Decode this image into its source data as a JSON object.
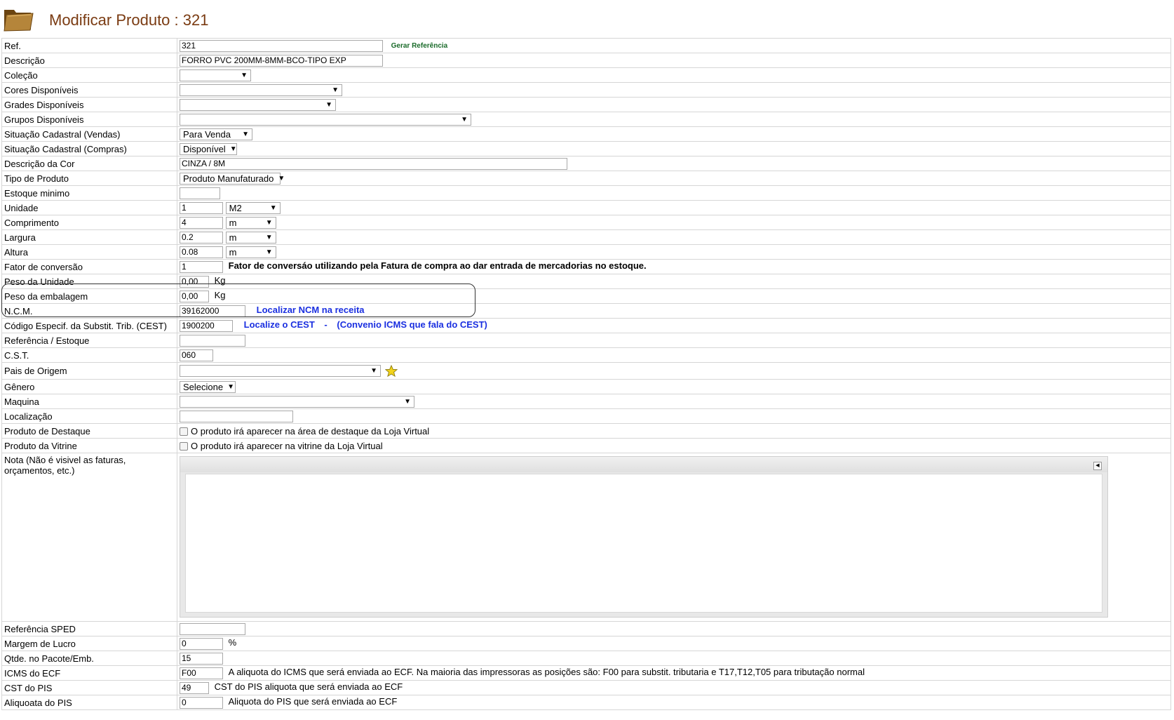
{
  "header": {
    "title": "Modificar Produto : 321"
  },
  "ref": {
    "label": "Ref.",
    "value": "321",
    "gen_link": "Gerar Referência"
  },
  "descricao": {
    "label": "Descrição",
    "value": "FORRO PVC 200MM-8MM-BCO-TIPO EXP"
  },
  "colecao": {
    "label": "Coleção",
    "value": ""
  },
  "cores": {
    "label": "Cores Disponíveis",
    "value": ""
  },
  "grades": {
    "label": "Grades Disponíveis",
    "value": ""
  },
  "grupos": {
    "label": "Grupos Disponíveis",
    "value": ""
  },
  "situacao_vendas": {
    "label": "Situação Cadastral (Vendas)",
    "value": "Para Venda"
  },
  "situacao_compras": {
    "label": "Situação Cadastral (Compras)",
    "value": "Disponível"
  },
  "descricao_cor": {
    "label": "Descrição da Cor",
    "value": "CINZA / 8M"
  },
  "tipo_produto": {
    "label": "Tipo de Produto",
    "value": "Produto Manufaturado"
  },
  "estoque_minimo": {
    "label": "Estoque minimo",
    "value": ""
  },
  "unidade": {
    "label": "Unidade",
    "value": "1",
    "unit": "M2"
  },
  "comprimento": {
    "label": "Comprimento",
    "value": "4",
    "unit": "m"
  },
  "largura": {
    "label": "Largura",
    "value": "0.2",
    "unit": "m"
  },
  "altura": {
    "label": "Altura",
    "value": "0.08",
    "unit": "m"
  },
  "fator": {
    "label": "Fator de conversão",
    "value": "1",
    "note": "Fator de conversáo utilizando pela Fatura de compra ao dar entrada de mercadorias no estoque."
  },
  "peso_unidade": {
    "label": "Peso da Unidade",
    "value": "0,00",
    "unit": "Kg"
  },
  "peso_embalagem": {
    "label": "Peso da embalagem",
    "value": "0,00",
    "unit": "Kg"
  },
  "ncm": {
    "label": "N.C.M.",
    "value": "39162000",
    "link": "Localizar NCM na receita"
  },
  "cest": {
    "label": "Código Especif. da Substit. Trib. (CEST)",
    "value": "1900200",
    "link1": "Localize o CEST",
    "sep": "-",
    "link2": "(Convenio ICMS que fala do CEST)"
  },
  "ref_estoque": {
    "label": "Referência / Estoque",
    "value": ""
  },
  "cst": {
    "label": "C.S.T.",
    "value": "060"
  },
  "pais": {
    "label": "Pais de Origem",
    "value": ""
  },
  "genero": {
    "label": "Gênero",
    "value": "Selecione"
  },
  "maquina": {
    "label": "Maquina",
    "value": ""
  },
  "localizacao": {
    "label": "Localização",
    "value": ""
  },
  "destaque": {
    "label": "Produto de Destaque",
    "text": "O produto irá aparecer na área de destaque da Loja Virtual"
  },
  "vitrine": {
    "label": "Produto da Vitrine",
    "text": "O produto irá aparecer na vitrine da Loja Virtual"
  },
  "nota": {
    "label": "Nota (Não é visivel as faturas, orçamentos, etc.)"
  },
  "ref_sped": {
    "label": "Referência SPED",
    "value": ""
  },
  "margem": {
    "label": "Margem de Lucro",
    "value": "0",
    "unit": "%"
  },
  "qtde": {
    "label": "Qtde. no Pacote/Emb.",
    "value": "15"
  },
  "icms": {
    "label": "ICMS do ECF",
    "value": "F00",
    "note": "A aliquota do ICMS que será enviada ao ECF. Na maioria das impressoras as posições são: F00 para substit. tributaria e T17,T12,T05 para tributação normal"
  },
  "cst_pis": {
    "label": "CST do PIS",
    "value": "49",
    "note": "CST do PIS aliquota que será enviada ao ECF"
  },
  "aliq_pis": {
    "label": "Aliquoata do PIS",
    "value": "0",
    "note": "Aliquota do PIS que será enviada ao ECF"
  }
}
